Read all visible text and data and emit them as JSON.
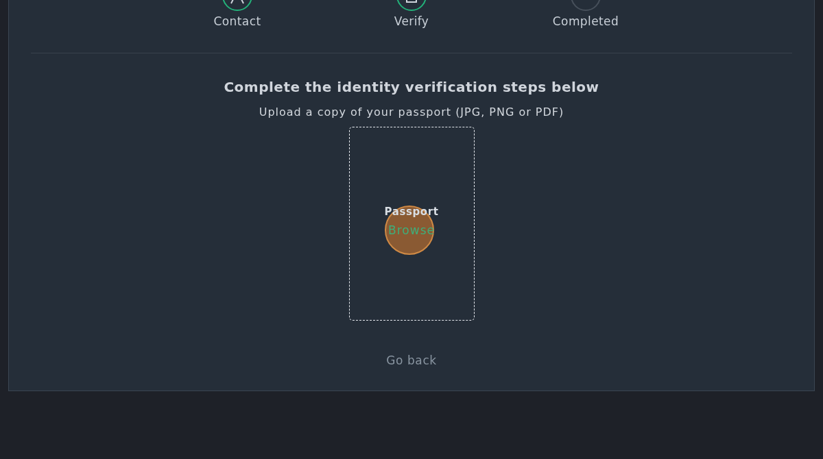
{
  "steps": [
    {
      "label": "Contact",
      "reached": true
    },
    {
      "label": "Verify",
      "reached": true
    },
    {
      "label": "Completed",
      "reached": false
    }
  ],
  "heading": "Complete the identity verification steps below",
  "instruction": "Upload a copy of your passport (JPG, PNG or PDF)",
  "upload": {
    "document": "Passport",
    "action": "Browse"
  },
  "back_link": "Go back"
}
